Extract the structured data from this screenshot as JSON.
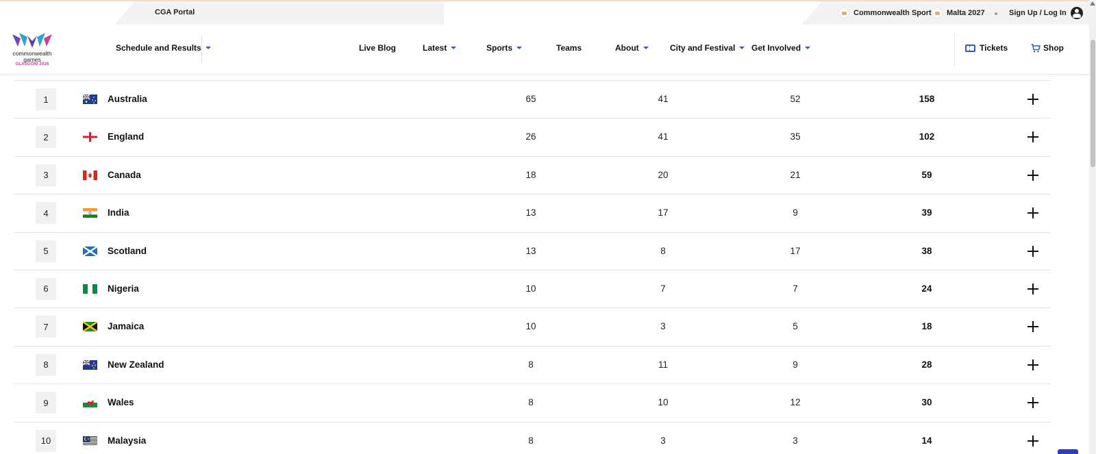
{
  "topbar": {
    "portal_label": "CGA Portal",
    "commonwealth_sport_label": "Commonwealth Sport",
    "malta_label": "Malta 2027",
    "signin_label": "Sign Up / Log In"
  },
  "logo": {
    "line1": "commonwealth",
    "line2": "games",
    "line3": "GLASGOW 2026"
  },
  "nav": {
    "schedule": "Schedule and Results",
    "live_blog": "Live Blog",
    "latest": "Latest",
    "sports": "Sports",
    "teams": "Teams",
    "about": "About",
    "city": "City and Festival",
    "involved": "Get Involved",
    "tickets": "Tickets",
    "shop": "Shop"
  },
  "colors": {
    "accent": "#3954d6",
    "logo_pink": "#c2449b"
  },
  "medal_table": {
    "rows": [
      {
        "rank": "1",
        "country": "Australia",
        "flag": "australia",
        "gold": "65",
        "silver": "41",
        "bronze": "52",
        "total": "158"
      },
      {
        "rank": "2",
        "country": "England",
        "flag": "england",
        "gold": "26",
        "silver": "41",
        "bronze": "35",
        "total": "102"
      },
      {
        "rank": "3",
        "country": "Canada",
        "flag": "canada",
        "gold": "18",
        "silver": "20",
        "bronze": "21",
        "total": "59"
      },
      {
        "rank": "4",
        "country": "India",
        "flag": "india",
        "gold": "13",
        "silver": "17",
        "bronze": "9",
        "total": "39"
      },
      {
        "rank": "5",
        "country": "Scotland",
        "flag": "scotland",
        "gold": "13",
        "silver": "8",
        "bronze": "17",
        "total": "38"
      },
      {
        "rank": "6",
        "country": "Nigeria",
        "flag": "nigeria",
        "gold": "10",
        "silver": "7",
        "bronze": "7",
        "total": "24"
      },
      {
        "rank": "7",
        "country": "Jamaica",
        "flag": "jamaica",
        "gold": "10",
        "silver": "3",
        "bronze": "5",
        "total": "18"
      },
      {
        "rank": "8",
        "country": "New Zealand",
        "flag": "new-zealand",
        "gold": "8",
        "silver": "11",
        "bronze": "9",
        "total": "28"
      },
      {
        "rank": "9",
        "country": "Wales",
        "flag": "wales",
        "gold": "8",
        "silver": "10",
        "bronze": "12",
        "total": "30"
      },
      {
        "rank": "10",
        "country": "Malaysia",
        "flag": "malaysia",
        "gold": "8",
        "silver": "3",
        "bronze": "3",
        "total": "14"
      }
    ]
  }
}
